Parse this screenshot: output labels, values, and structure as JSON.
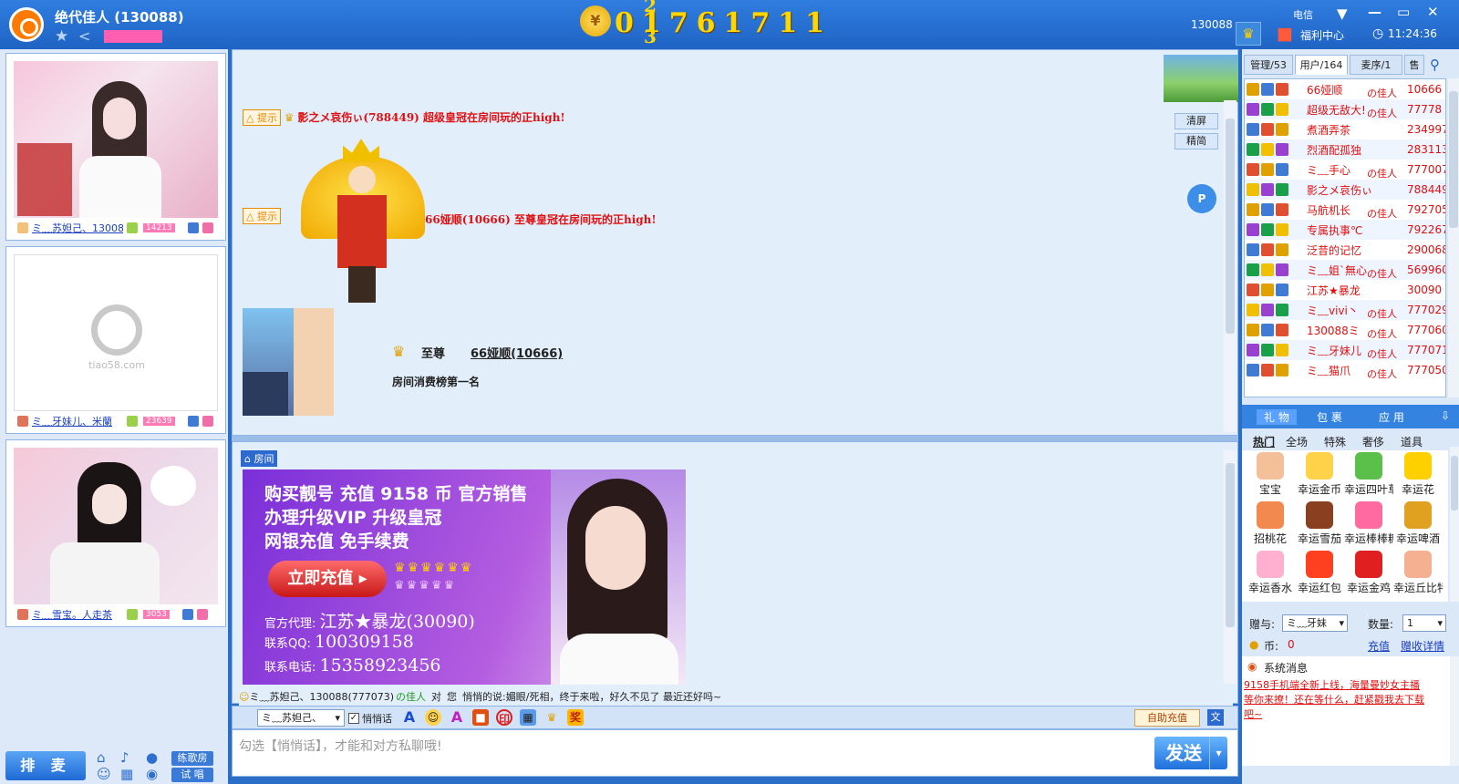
{
  "window": {
    "room_title": "绝代佳人 (130088)",
    "counter_digits": "01761711",
    "counter_small_top": "2",
    "counter_small_bottom": "3",
    "room_id_short": "130088",
    "isp": "电信",
    "welfare_label": "福利中心",
    "time": "11:24:36",
    "controls": [
      "▼",
      "—",
      "▭",
      "✕"
    ]
  },
  "left": {
    "panels": [
      {
        "name": "ミ﹏苏妲己、130088",
        "number": "14213"
      },
      {
        "name": "ミ﹏牙妹儿、米蘭",
        "number": "23639",
        "placeholder": "tiao58.com"
      },
      {
        "name": "ミ﹏雪宝。人走茶",
        "number": "3053"
      }
    ],
    "queue_button": "排 麦",
    "song_room_button": "练歌房",
    "trial_sing_button": "试 唱"
  },
  "chat": {
    "tip_label": "提示",
    "msg1": "影之メ哀伤ぃ(788449) 超级皇冠在房间玩的正high!",
    "msg2": "66娅顺(10666) 至尊皇冠在房间玩的正high!",
    "clear_button": "清屏",
    "simple_button": "精简",
    "supreme_label": "至尊",
    "top_user": "66娅顺(10666)",
    "rank_text": "房间消费榜第一名",
    "p_badge": "P"
  },
  "room": {
    "room_label": "房间",
    "ad": {
      "line1": "购买靓号  充值 9158 币  官方销售",
      "line2": "办理升级VIP  升级皇冠",
      "line3": "网银充值  免手续费",
      "button": "立即充值 ▸",
      "agent_label": "官方代理:",
      "agent_value": "江苏★暴龙(30090)",
      "qq_label": "联系QQ:",
      "qq_value": "100309158",
      "phone_label": "联系电话:",
      "phone_value": "15358923456"
    },
    "whisper": {
      "from": "ミ﹏苏妲己、130088(777073)",
      "from_tag": "の佳人",
      "to_label": "对",
      "to": "您",
      "says": "悄悄的说:",
      "content": "媚眼/死相，终于来啦，好久不见了 最近还好吗~"
    }
  },
  "input": {
    "target": "ミ﹏苏妲己、",
    "whisper_checkbox_label": "悄悄话",
    "auto_recharge": "自助充值",
    "placeholder": "勾选【悄悄话】，才能和对方私聊哦!",
    "send_button": "发送"
  },
  "users": {
    "tabs": [
      "管理/53",
      "用户/164",
      "麦序/1",
      "售"
    ],
    "rows": [
      {
        "name": "66娅顺",
        "tag": "の佳人",
        "id": "10666"
      },
      {
        "name": "超级无敌大!",
        "tag": "の佳人",
        "id": "77778"
      },
      {
        "name": "煮酒弄茶",
        "tag": "",
        "id": "234997"
      },
      {
        "name": "烈酒配孤独",
        "tag": "",
        "id": "283113"
      },
      {
        "name": "ミ﹏手心",
        "tag": "の佳人",
        "id": "777007"
      },
      {
        "name": "影之メ哀伤ぃ",
        "tag": "",
        "id": "788449"
      },
      {
        "name": "马航机长",
        "tag": "の佳人",
        "id": "792705"
      },
      {
        "name": "专属执事℃",
        "tag": "",
        "id": "792267"
      },
      {
        "name": "泛昔的记忆",
        "tag": "",
        "id": "290068"
      },
      {
        "name": "ミ﹏姐`無心",
        "tag": "の佳人",
        "id": "569960"
      },
      {
        "name": "江苏★暴龙",
        "tag": "",
        "id": "30090"
      },
      {
        "name": "ミ﹏vivi丶",
        "tag": "の佳人",
        "id": "777029"
      },
      {
        "name": "130088ミ",
        "tag": "の佳人",
        "id": "777060"
      },
      {
        "name": "ミ﹏牙妹儿",
        "tag": "の佳人",
        "id": "777071"
      },
      {
        "name": "ミ﹏猫爪",
        "tag": "の佳人",
        "id": "777050"
      }
    ]
  },
  "gifts": {
    "tabs": [
      "礼 物",
      "包 裹",
      "应 用"
    ],
    "subtabs": [
      "热门",
      "全场",
      "特殊",
      "奢侈",
      "道具"
    ],
    "items": [
      "宝宝",
      "幸运金币",
      "幸运四叶草",
      "幸运花",
      "招桃花",
      "幸运雪茄",
      "幸运棒棒糖",
      "幸运啤酒",
      "幸运香水",
      "幸运红包",
      "幸运金鸡",
      "幸运丘比特"
    ],
    "give_to_label": "赠与:",
    "give_to_value": "ミ﹏牙妹",
    "qty_label": "数量:",
    "qty_value": "1",
    "coin_label": "币:",
    "coin_value": "0",
    "recharge_link": "充值",
    "details_link": "赠收详情",
    "sys_title": "系统消息",
    "sys_text": "9158手机端全新上线，海量曼妙女主播等你来撩！还在等什么，赶紧戳我去下载吧~"
  }
}
